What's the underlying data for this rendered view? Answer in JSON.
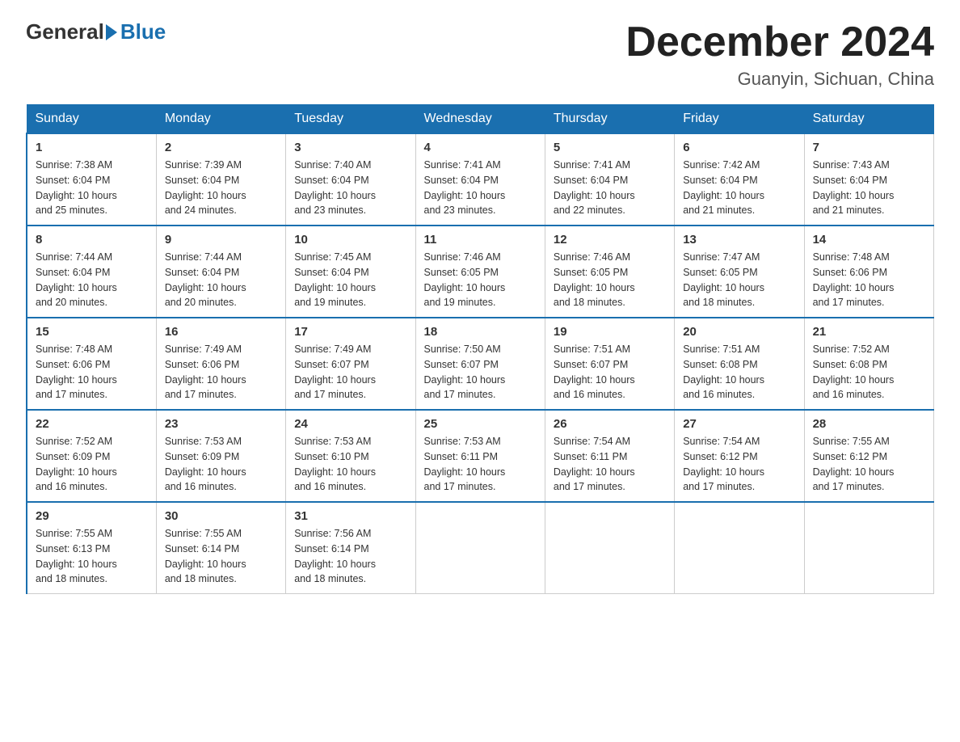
{
  "logo": {
    "general": "General",
    "blue": "Blue"
  },
  "title": {
    "month_year": "December 2024",
    "location": "Guanyin, Sichuan, China"
  },
  "weekdays": [
    "Sunday",
    "Monday",
    "Tuesday",
    "Wednesday",
    "Thursday",
    "Friday",
    "Saturday"
  ],
  "weeks": [
    [
      {
        "day": "1",
        "sunrise": "7:38 AM",
        "sunset": "6:04 PM",
        "daylight": "10 hours and 25 minutes."
      },
      {
        "day": "2",
        "sunrise": "7:39 AM",
        "sunset": "6:04 PM",
        "daylight": "10 hours and 24 minutes."
      },
      {
        "day": "3",
        "sunrise": "7:40 AM",
        "sunset": "6:04 PM",
        "daylight": "10 hours and 23 minutes."
      },
      {
        "day": "4",
        "sunrise": "7:41 AM",
        "sunset": "6:04 PM",
        "daylight": "10 hours and 23 minutes."
      },
      {
        "day": "5",
        "sunrise": "7:41 AM",
        "sunset": "6:04 PM",
        "daylight": "10 hours and 22 minutes."
      },
      {
        "day": "6",
        "sunrise": "7:42 AM",
        "sunset": "6:04 PM",
        "daylight": "10 hours and 21 minutes."
      },
      {
        "day": "7",
        "sunrise": "7:43 AM",
        "sunset": "6:04 PM",
        "daylight": "10 hours and 21 minutes."
      }
    ],
    [
      {
        "day": "8",
        "sunrise": "7:44 AM",
        "sunset": "6:04 PM",
        "daylight": "10 hours and 20 minutes."
      },
      {
        "day": "9",
        "sunrise": "7:44 AM",
        "sunset": "6:04 PM",
        "daylight": "10 hours and 20 minutes."
      },
      {
        "day": "10",
        "sunrise": "7:45 AM",
        "sunset": "6:04 PM",
        "daylight": "10 hours and 19 minutes."
      },
      {
        "day": "11",
        "sunrise": "7:46 AM",
        "sunset": "6:05 PM",
        "daylight": "10 hours and 19 minutes."
      },
      {
        "day": "12",
        "sunrise": "7:46 AM",
        "sunset": "6:05 PM",
        "daylight": "10 hours and 18 minutes."
      },
      {
        "day": "13",
        "sunrise": "7:47 AM",
        "sunset": "6:05 PM",
        "daylight": "10 hours and 18 minutes."
      },
      {
        "day": "14",
        "sunrise": "7:48 AM",
        "sunset": "6:06 PM",
        "daylight": "10 hours and 17 minutes."
      }
    ],
    [
      {
        "day": "15",
        "sunrise": "7:48 AM",
        "sunset": "6:06 PM",
        "daylight": "10 hours and 17 minutes."
      },
      {
        "day": "16",
        "sunrise": "7:49 AM",
        "sunset": "6:06 PM",
        "daylight": "10 hours and 17 minutes."
      },
      {
        "day": "17",
        "sunrise": "7:49 AM",
        "sunset": "6:07 PM",
        "daylight": "10 hours and 17 minutes."
      },
      {
        "day": "18",
        "sunrise": "7:50 AM",
        "sunset": "6:07 PM",
        "daylight": "10 hours and 17 minutes."
      },
      {
        "day": "19",
        "sunrise": "7:51 AM",
        "sunset": "6:07 PM",
        "daylight": "10 hours and 16 minutes."
      },
      {
        "day": "20",
        "sunrise": "7:51 AM",
        "sunset": "6:08 PM",
        "daylight": "10 hours and 16 minutes."
      },
      {
        "day": "21",
        "sunrise": "7:52 AM",
        "sunset": "6:08 PM",
        "daylight": "10 hours and 16 minutes."
      }
    ],
    [
      {
        "day": "22",
        "sunrise": "7:52 AM",
        "sunset": "6:09 PM",
        "daylight": "10 hours and 16 minutes."
      },
      {
        "day": "23",
        "sunrise": "7:53 AM",
        "sunset": "6:09 PM",
        "daylight": "10 hours and 16 minutes."
      },
      {
        "day": "24",
        "sunrise": "7:53 AM",
        "sunset": "6:10 PM",
        "daylight": "10 hours and 16 minutes."
      },
      {
        "day": "25",
        "sunrise": "7:53 AM",
        "sunset": "6:11 PM",
        "daylight": "10 hours and 17 minutes."
      },
      {
        "day": "26",
        "sunrise": "7:54 AM",
        "sunset": "6:11 PM",
        "daylight": "10 hours and 17 minutes."
      },
      {
        "day": "27",
        "sunrise": "7:54 AM",
        "sunset": "6:12 PM",
        "daylight": "10 hours and 17 minutes."
      },
      {
        "day": "28",
        "sunrise": "7:55 AM",
        "sunset": "6:12 PM",
        "daylight": "10 hours and 17 minutes."
      }
    ],
    [
      {
        "day": "29",
        "sunrise": "7:55 AM",
        "sunset": "6:13 PM",
        "daylight": "10 hours and 18 minutes."
      },
      {
        "day": "30",
        "sunrise": "7:55 AM",
        "sunset": "6:14 PM",
        "daylight": "10 hours and 18 minutes."
      },
      {
        "day": "31",
        "sunrise": "7:56 AM",
        "sunset": "6:14 PM",
        "daylight": "10 hours and 18 minutes."
      },
      null,
      null,
      null,
      null
    ]
  ],
  "labels": {
    "sunrise": "Sunrise:",
    "sunset": "Sunset:",
    "daylight": "Daylight:"
  }
}
